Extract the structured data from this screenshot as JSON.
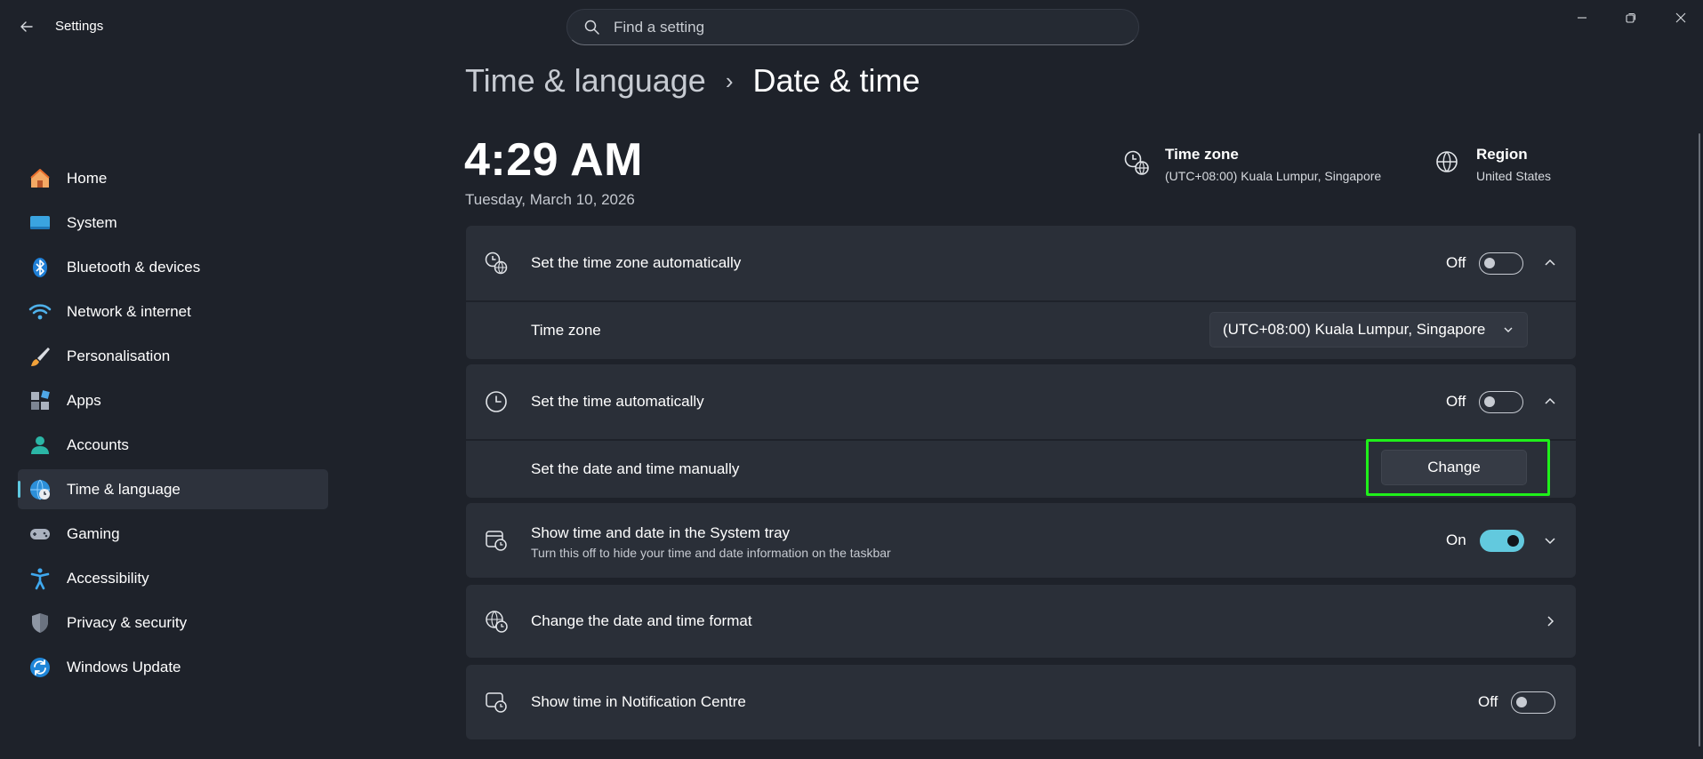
{
  "app": {
    "title": "Settings"
  },
  "search": {
    "placeholder": "Find a setting"
  },
  "sidebar": {
    "items": [
      {
        "label": "Home",
        "icon": "home-icon"
      },
      {
        "label": "System",
        "icon": "system-icon"
      },
      {
        "label": "Bluetooth & devices",
        "icon": "bluetooth-icon"
      },
      {
        "label": "Network & internet",
        "icon": "wifi-icon"
      },
      {
        "label": "Personalisation",
        "icon": "brush-icon"
      },
      {
        "label": "Apps",
        "icon": "apps-icon"
      },
      {
        "label": "Accounts",
        "icon": "account-icon"
      },
      {
        "label": "Time & language",
        "icon": "time-language-icon",
        "active": true
      },
      {
        "label": "Gaming",
        "icon": "gamepad-icon"
      },
      {
        "label": "Accessibility",
        "icon": "accessibility-icon"
      },
      {
        "label": "Privacy & security",
        "icon": "shield-icon"
      },
      {
        "label": "Windows Update",
        "icon": "update-icon"
      }
    ]
  },
  "header": {
    "parent": "Time & language",
    "separator": "›",
    "current": "Date & time"
  },
  "clock": {
    "time": "4:29 AM",
    "date": "Tuesday, March 10, 2026"
  },
  "info": {
    "timezone": {
      "title": "Time zone",
      "value": "(UTC+08:00) Kuala Lumpur, Singapore"
    },
    "region": {
      "title": "Region",
      "value": "United States"
    }
  },
  "settings": {
    "auto_timezone": {
      "label": "Set the time zone automatically",
      "state": "Off",
      "on": false
    },
    "timezone_row": {
      "label": "Time zone",
      "selected": "(UTC+08:00) Kuala Lumpur, Singapore"
    },
    "auto_time": {
      "label": "Set the time automatically",
      "state": "Off",
      "on": false
    },
    "manual": {
      "label": "Set the date and time manually",
      "button": "Change"
    },
    "tray": {
      "label": "Show time and date in the System tray",
      "sub": "Turn this off to hide your time and date information on the taskbar",
      "state": "On",
      "on": true
    },
    "format": {
      "label": "Change the date and time format"
    },
    "notification": {
      "label": "Show time in Notification Centre",
      "state": "Off",
      "on": false
    }
  },
  "colors": {
    "accent": "#62c9de",
    "highlight": "#1ff01a",
    "background": "#1e222a",
    "card": "#2a2f38"
  }
}
